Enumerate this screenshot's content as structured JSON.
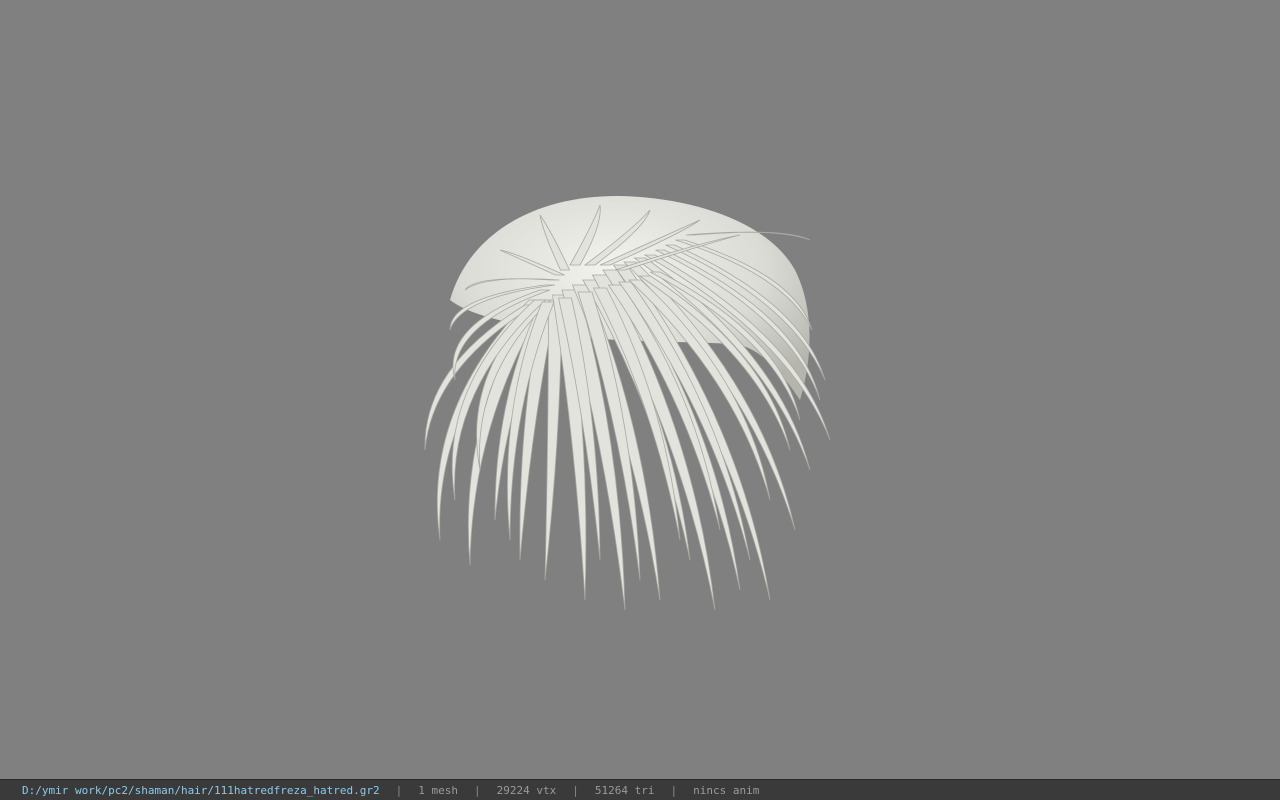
{
  "viewport": {
    "background_color": "#808080",
    "model_color": "#e6e6e1",
    "model_shadow_color": "#b9b9b3",
    "model_subject": "hair-mesh"
  },
  "status_bar": {
    "file_path": "D:/ymir work/pc2/shaman/hair/111hatredfreza_hatred.gr2",
    "separator": "|",
    "mesh_count": "1 mesh",
    "vertex_count": "29224 vtx",
    "triangle_count": "51264 tri",
    "anim_status": "nincs anim",
    "path_color": "#8ec9e8",
    "text_color": "#9a9a9a",
    "background_color": "#3a3a3a"
  }
}
